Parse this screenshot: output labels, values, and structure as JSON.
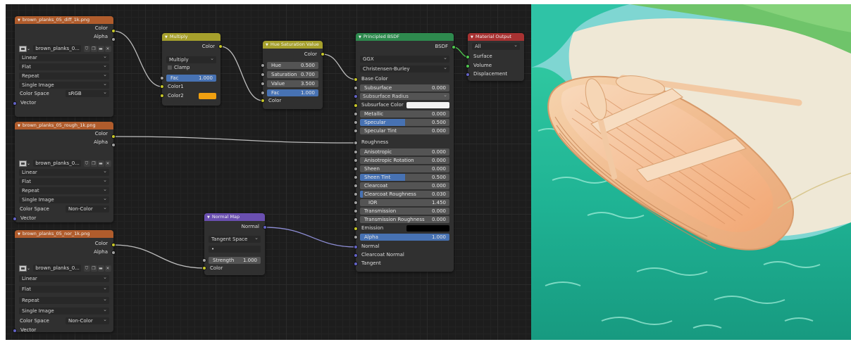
{
  "colors": {
    "header_image": "#b05c2c",
    "header_color": "#a6a02c",
    "header_shader": "#2e8a4e",
    "header_output": "#a83232",
    "header_vector": "#6a4fb0",
    "socket_color": "#c7c729",
    "socket_float": "#a1a1a1",
    "socket_vector": "#6363c7",
    "socket_shader": "#4fc74f",
    "slider_fill": "#4772b3",
    "color2_swatch": "#f0a010"
  },
  "node_diff": {
    "title": "brown_planks_05_diff_1k.png",
    "out_color": "Color",
    "out_alpha": "Alpha",
    "image_name": "brown_planks_0...",
    "interpolation": "Linear",
    "projection": "Flat",
    "extension": "Repeat",
    "source": "Single Image",
    "color_space_label": "Color Space",
    "color_space": "sRGB",
    "in_vector": "Vector"
  },
  "node_rough": {
    "title": "brown_planks_05_rough_1k.png",
    "out_color": "Color",
    "out_alpha": "Alpha",
    "image_name": "brown_planks_0...",
    "interpolation": "Linear",
    "projection": "Flat",
    "extension": "Repeat",
    "source": "Single Image",
    "color_space_label": "Color Space",
    "color_space": "Non-Color",
    "in_vector": "Vector"
  },
  "node_nor": {
    "title": "brown_planks_05_nor_1k.png",
    "out_color": "Color",
    "out_alpha": "Alpha",
    "image_name": "brown_planks_0...",
    "interpolation": "Linear",
    "projection": "Flat",
    "extension": "Repeat",
    "source": "Single Image",
    "color_space_label": "Color Space",
    "color_space": "Non-Color",
    "in_vector": "Vector"
  },
  "node_multiply": {
    "title": "Multiply",
    "out_color": "Color",
    "blend_mode": "Multiply",
    "clamp": "Clamp",
    "fac_label": "Fac",
    "fac_value": "1.000",
    "fac_fraction": 1.0,
    "in_color1": "Color1",
    "in_color2": "Color2"
  },
  "node_hsv": {
    "title": "Hue Saturation Value",
    "out_color": "Color",
    "hue_label": "Hue",
    "hue_value": "0.500",
    "sat_label": "Saturation",
    "sat_value": "0.700",
    "val_label": "Value",
    "val_value": "3.500",
    "fac_label": "Fac",
    "fac_value": "1.000",
    "fac_fraction": 1.0,
    "in_color": "Color"
  },
  "node_normal": {
    "title": "Normal Map",
    "out_normal": "Normal",
    "space": "Tangent Space",
    "uv": "•",
    "strength_label": "Strength",
    "strength_value": "1.000",
    "in_color": "Color"
  },
  "node_bsdf": {
    "title": "Principled BSDF",
    "out_bsdf": "BSDF",
    "distribution": "GGX",
    "subsurface_method": "Christensen-Burley",
    "base_color": "Base Color",
    "subsurface_label": "Subsurface",
    "subsurface_value": "0.000",
    "subsurface_radius": "Subsurface Radius",
    "subsurface_color": "Subsurface Color",
    "metallic_label": "Metallic",
    "metallic_value": "0.000",
    "specular_label": "Specular",
    "specular_value": "0.500",
    "specular_fraction": 0.5,
    "specular_tint_label": "Specular Tint",
    "specular_tint_value": "0.000",
    "roughness": "Roughness",
    "anisotropic_label": "Anisotropic",
    "anisotropic_value": "0.000",
    "aniso_rot_label": "Anisotropic Rotation",
    "aniso_rot_value": "0.000",
    "sheen_label": "Sheen",
    "sheen_value": "0.000",
    "sheen_tint_label": "Sheen Tint",
    "sheen_tint_value": "0.500",
    "sheen_tint_fraction": 0.5,
    "clearcoat_label": "Clearcoat",
    "clearcoat_value": "0.000",
    "clearcoat_rough_label": "Clearcoat Roughness",
    "clearcoat_rough_value": "0.030",
    "clearcoat_rough_fraction": 0.03,
    "ior_label": "IOR",
    "ior_value": "1.450",
    "transmission_label": "Transmission",
    "transmission_value": "0.000",
    "trans_rough_label": "Transmission Roughness",
    "trans_rough_value": "0.000",
    "emission": "Emission",
    "alpha_label": "Alpha",
    "alpha_value": "1.000",
    "alpha_fraction": 1.0,
    "normal": "Normal",
    "clearcoat_normal": "Clearcoat Normal",
    "tangent": "Tangent"
  },
  "node_output": {
    "title": "Material Output",
    "target": "All",
    "in_surface": "Surface",
    "in_volume": "Volume",
    "in_displacement": "Displacement"
  }
}
